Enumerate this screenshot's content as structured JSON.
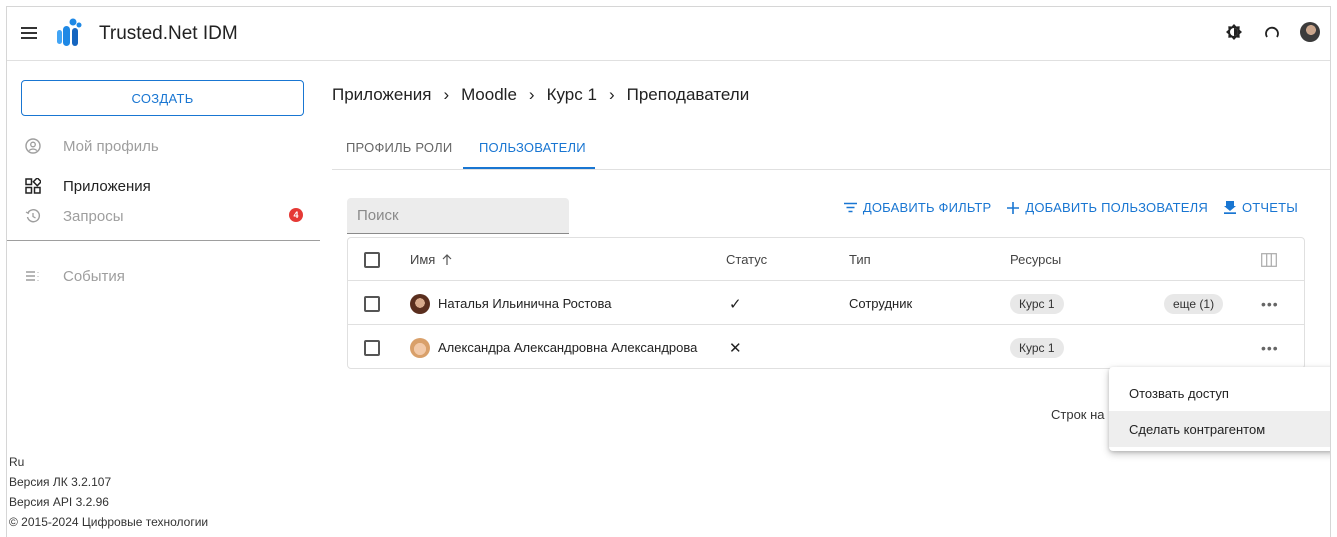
{
  "header": {
    "title": "Trusted.Net IDM",
    "icons": [
      "menu-icon",
      "theme-toggle-icon",
      "refresh-icon",
      "user-avatar"
    ]
  },
  "sidebar": {
    "create_label": "СОЗДАТЬ",
    "items": [
      {
        "label": "Мой профиль",
        "icon": "profile-icon",
        "active": false
      },
      {
        "label": "Приложения",
        "icon": "apps-icon",
        "active": true
      },
      {
        "label": "Запросы",
        "icon": "history-icon",
        "active": false,
        "badge": "4"
      },
      {
        "label": "События",
        "icon": "list-icon",
        "active": false
      }
    ],
    "footer": {
      "lang": "Ru",
      "version_lk": "Версия ЛК 3.2.107",
      "version_api": "Версия API 3.2.96",
      "copyright": "© 2015-2024 Цифровые технологии"
    }
  },
  "breadcrumb": [
    "Приложения",
    "Moodle",
    "Курс 1",
    "Преподаватели"
  ],
  "tabs": [
    {
      "label": "ПРОФИЛЬ РОЛИ",
      "active": false
    },
    {
      "label": "ПОЛЬЗОВАТЕЛИ",
      "active": true
    }
  ],
  "search": {
    "placeholder": "Поиск",
    "value": ""
  },
  "actions": {
    "add_filter": "ДОБАВИТЬ ФИЛЬТР",
    "add_user": "ДОБАВИТЬ ПОЛЬЗОВАТЕЛЯ",
    "reports": "ОТЧЕТЫ"
  },
  "table": {
    "columns": {
      "name": "Имя",
      "status": "Статус",
      "type": "Тип",
      "resources": "Ресурсы"
    },
    "rows": [
      {
        "name": "Наталья Ильинична Ростова",
        "status": "✓",
        "type": "Сотрудник",
        "resource": "Курс 1",
        "more": "еще (1)"
      },
      {
        "name": "Александра Александровна Александрова",
        "status": "✕",
        "type": "",
        "resource": "Курс 1",
        "more": ""
      }
    ]
  },
  "pagination": {
    "rows_per_page_label": "Строк на"
  },
  "context_menu": {
    "items": [
      "Отозвать доступ",
      "Сделать контрагентом"
    ]
  },
  "colors": {
    "accent": "#1976d2",
    "badge": "#e53935"
  }
}
